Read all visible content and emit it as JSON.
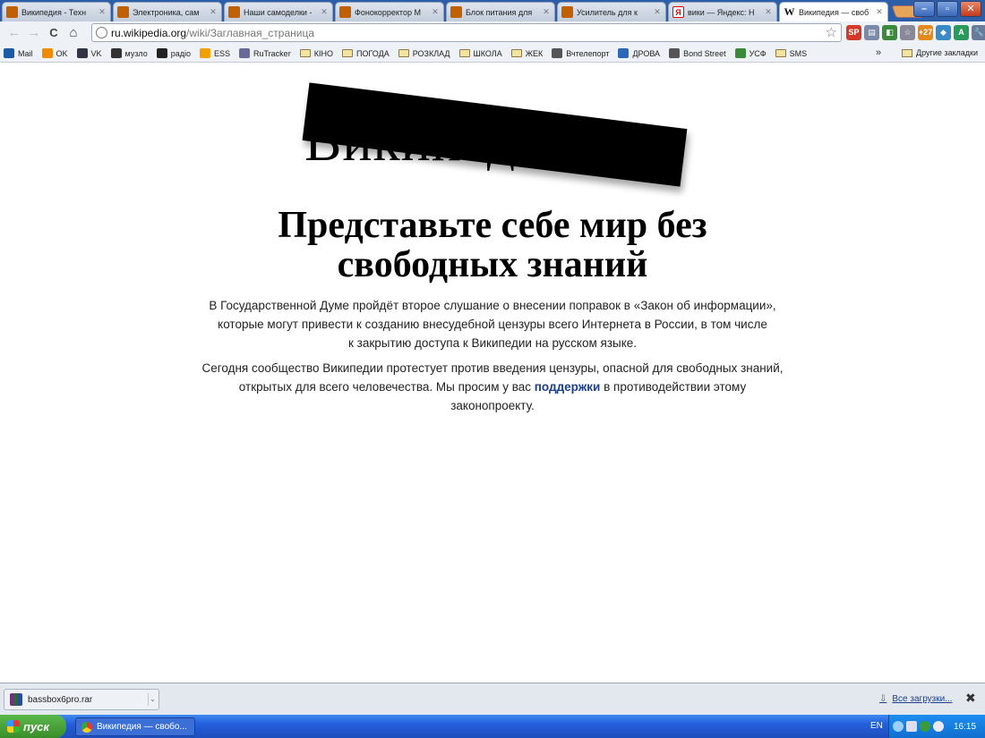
{
  "tabs": [
    {
      "title": "Википедия - Техн",
      "icon": "t"
    },
    {
      "title": "Электроника, сам",
      "icon": "t"
    },
    {
      "title": "Наши самоделки -",
      "icon": "t"
    },
    {
      "title": "Фонокорректор М",
      "icon": "t"
    },
    {
      "title": "Блок питания для",
      "icon": "t"
    },
    {
      "title": "Усилитель для к",
      "icon": "t"
    },
    {
      "title": "вики — Яндекс: Н",
      "icon": "y"
    },
    {
      "title": "Википедия — своб",
      "icon": "w"
    }
  ],
  "tab_close_glyph": "✕",
  "window_controls": {
    "minimize": "–",
    "maximize": "▫",
    "close": "✕"
  },
  "toolbar": {
    "back": "←",
    "forward": "→",
    "reload": "C",
    "home": "⌂",
    "url_host": "ru.wikipedia.org",
    "url_path": "/wiki/Заглавная_страница",
    "star": "☆"
  },
  "extensions": [
    {
      "label": "SP",
      "color": "#d23a2a"
    },
    {
      "label": "▤",
      "color": "#7a8aa8"
    },
    {
      "label": "◧",
      "color": "#3a8a3a"
    },
    {
      "label": "☆",
      "color": "#889"
    },
    {
      "label": "+27",
      "color": "#e38a1a"
    },
    {
      "label": "◆",
      "color": "#3a8ac8"
    },
    {
      "label": "A",
      "color": "#2a9a5a"
    },
    {
      "label": "🔧",
      "color": "#6a7a9a"
    }
  ],
  "bookmarks": [
    {
      "label": "Mail",
      "type": "icon",
      "color": "#1a5aa8"
    },
    {
      "label": "OK",
      "type": "icon",
      "color": "#f08a00"
    },
    {
      "label": "VK",
      "type": "icon",
      "color": "#334"
    },
    {
      "label": "музло",
      "type": "icon",
      "color": "#333"
    },
    {
      "label": "радіо",
      "type": "icon",
      "color": "#222"
    },
    {
      "label": "ESS",
      "type": "icon",
      "color": "#f0a000"
    },
    {
      "label": "RuTracker",
      "type": "icon",
      "color": "#6a6a9a"
    },
    {
      "label": "КІНО",
      "type": "folder"
    },
    {
      "label": "ПОГОДА",
      "type": "folder"
    },
    {
      "label": "РОЗКЛАД",
      "type": "folder"
    },
    {
      "label": "ШКОЛА",
      "type": "folder"
    },
    {
      "label": "ЖЕК",
      "type": "folder"
    },
    {
      "label": "Вчтелепорт",
      "type": "icon",
      "color": "#555"
    },
    {
      "label": "ДРОВА",
      "type": "icon",
      "color": "#2a6ab8"
    },
    {
      "label": "Bond Street",
      "type": "icon",
      "color": "#555"
    },
    {
      "label": "УСФ",
      "type": "icon",
      "color": "#3a8a3a"
    },
    {
      "label": "SMS",
      "type": "folder"
    }
  ],
  "bookmarks_more": "»",
  "bookmarks_other": "Другие закладки",
  "page": {
    "logo_text": "Википедия",
    "headline_line1": "Представьте себе мир без",
    "headline_line2": "свободных знаний",
    "para1_line1": "В Государственной Думе пройдёт второе слушание о внесении поправок в «Закон об информации»,",
    "para1_line2": "которые могут привести к созданию внесудебной цензуры всего Интернета в России, в том числе",
    "para1_line3": "к закрытию доступа к Википедии на русском языке.",
    "para2_line1": "Сегодня сообщество Википедии протестует против введения цензуры, опасной для свободных знаний,",
    "para2_line2_pre": "открытых для всего человечества. Мы просим у вас ",
    "para2_link": "поддержки",
    "para2_line2_post": " в противодействии этому",
    "para2_line3": "законопроекту."
  },
  "downloads": {
    "file": "bassbox6pro.rar",
    "dropdown": "⌄",
    "show_all": "Все загрузки...",
    "close": "✖"
  },
  "taskbar": {
    "start": "пуск",
    "task_title": "Википедия — свобо...",
    "lang": "EN",
    "clock": "16:15"
  }
}
